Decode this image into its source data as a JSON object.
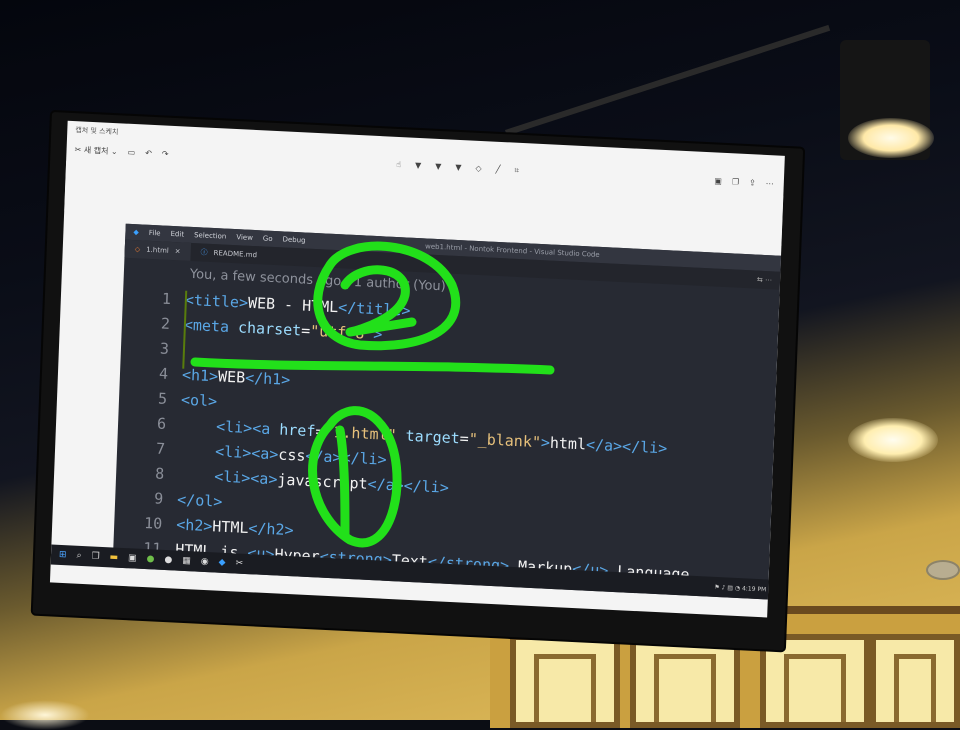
{
  "snipping_tool": {
    "title": "캡처 및 스케치",
    "new_label": "새 캡처"
  },
  "vscode": {
    "menu": [
      "File",
      "Edit",
      "Selection",
      "View",
      "Go",
      "Debug"
    ],
    "window_title": "web1.html - Nontok Frontend - Visual Studio Code",
    "tabs": [
      {
        "label": "1.html",
        "close": "×"
      },
      {
        "label": "README.md"
      }
    ],
    "blame": "You, a few seconds ago | 1 author (You)",
    "lines": [
      {
        "n": "1",
        "tokens": [
          [
            "t-tag",
            "<title>"
          ],
          [
            "t-txt",
            "WEB - HTML"
          ],
          [
            "t-tag",
            "</title>"
          ]
        ]
      },
      {
        "n": "2",
        "tokens": [
          [
            "t-tag",
            "<meta "
          ],
          [
            "t-attr",
            "charset"
          ],
          [
            "t-txt",
            "="
          ],
          [
            "t-str",
            "\"utf-8\""
          ],
          [
            "t-tag",
            ">"
          ]
        ]
      },
      {
        "n": "3",
        "tokens": []
      },
      {
        "n": "4",
        "tokens": [
          [
            "t-tag",
            "<h1>"
          ],
          [
            "t-txt",
            "WEB"
          ],
          [
            "t-tag",
            "</h1>"
          ]
        ]
      },
      {
        "n": "5",
        "tokens": [
          [
            "t-tag",
            "<ol>"
          ]
        ]
      },
      {
        "n": "6",
        "tokens": [
          [
            "t-txt",
            "    "
          ],
          [
            "t-tag",
            "<li><a "
          ],
          [
            "t-attr",
            "href"
          ],
          [
            "t-txt",
            "="
          ],
          [
            "t-str",
            "\"1.html\""
          ],
          [
            "t-txt",
            " "
          ],
          [
            "t-attr",
            "target"
          ],
          [
            "t-txt",
            "="
          ],
          [
            "t-str",
            "\"_blank\""
          ],
          [
            "t-tag",
            ">"
          ],
          [
            "t-txt",
            "html"
          ],
          [
            "t-tag",
            "</a></li>"
          ]
        ]
      },
      {
        "n": "7",
        "tokens": [
          [
            "t-txt",
            "    "
          ],
          [
            "t-tag",
            "<li><a>"
          ],
          [
            "t-txt",
            "css"
          ],
          [
            "t-tag",
            "</a></li>"
          ]
        ]
      },
      {
        "n": "8",
        "tokens": [
          [
            "t-txt",
            "    "
          ],
          [
            "t-tag",
            "<li><a>"
          ],
          [
            "t-txt",
            "javascript"
          ],
          [
            "t-tag",
            "</a></li>"
          ]
        ]
      },
      {
        "n": "9",
        "tokens": [
          [
            "t-tag",
            "</ol>"
          ]
        ]
      },
      {
        "n": "10",
        "tokens": [
          [
            "t-tag",
            "<h2>"
          ],
          [
            "t-txt",
            "HTML"
          ],
          [
            "t-tag",
            "</h2>"
          ]
        ]
      },
      {
        "n": "11",
        "tokens": [
          [
            "t-txt",
            "HTML is "
          ],
          [
            "t-tag",
            "<u>"
          ],
          [
            "t-txt",
            "Hyper"
          ],
          [
            "t-tag",
            "<strong>"
          ],
          [
            "t-txt",
            "Text"
          ],
          [
            "t-tag",
            "</strong>"
          ],
          [
            "t-txt",
            " Markup"
          ],
          [
            "t-tag",
            "</u>"
          ],
          [
            "t-txt",
            " Language."
          ]
        ]
      }
    ]
  },
  "taskbar": {
    "start": "⊞",
    "clock": "4:19 PM"
  },
  "annotations": {
    "circle_2": "2",
    "circle_1": "1",
    "color": "#22e01a"
  }
}
